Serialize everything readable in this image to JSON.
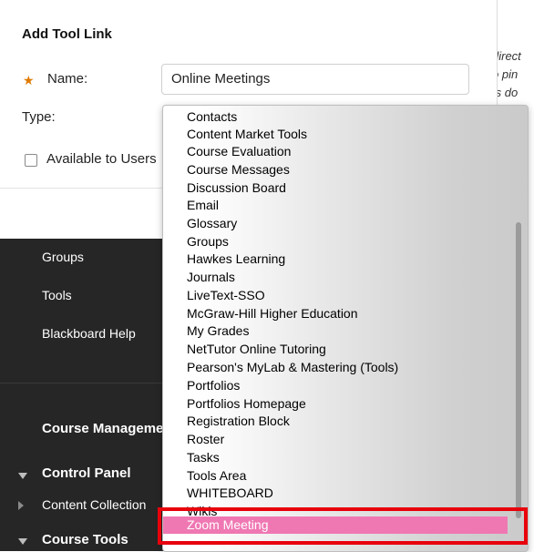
{
  "background_text": [
    "direct",
    "o pin",
    "ts do"
  ],
  "course_menu": {
    "items": [
      {
        "label": "Groups"
      },
      {
        "label": "Tools"
      },
      {
        "label": "Blackboard Help"
      }
    ],
    "section_heading": "Course Management",
    "control_panel": "Control Panel",
    "content_collection": "Content Collection",
    "course_tools": "Course Tools"
  },
  "dialog": {
    "title": "Add Tool Link",
    "name_label": "Name:",
    "name_value": "Online Meetings",
    "type_label": "Type:",
    "available_label": "Available to Users"
  },
  "dropdown": {
    "options": [
      "Contacts",
      "Content Market Tools",
      "Course Evaluation",
      "Course Messages",
      "Discussion Board",
      "Email",
      "Glossary",
      "Groups",
      "Hawkes Learning",
      "Journals",
      "LiveText-SSO",
      "McGraw-Hill Higher Education",
      "My Grades",
      "NetTutor Online Tutoring",
      "Pearson's MyLab & Mastering (Tools)",
      "Portfolios",
      "Portfolios Homepage",
      "Registration Block",
      "Roster",
      "Tasks",
      "Tools Area",
      "WHITEBOARD",
      "Wikis"
    ],
    "selected": "Zoom Meeting"
  },
  "colors": {
    "selected_bg": "#ef78b3",
    "highlight_border": "#e8000b",
    "required_star": "#e07a00"
  }
}
